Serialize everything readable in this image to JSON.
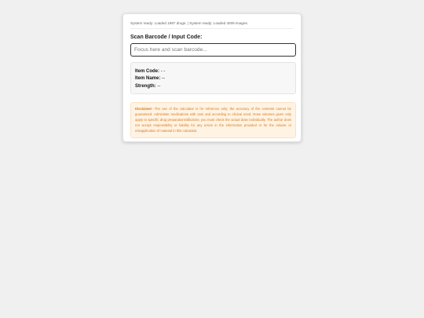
{
  "status": {
    "text": "System ready: Loaded 1987 drugs. | System ready: Loaded 4009 images."
  },
  "scan": {
    "label": "Scan Barcode / Input Code:",
    "placeholder": "Focus here and scan barcode...",
    "value": ""
  },
  "item": {
    "code_label": "Item Code:",
    "code_value": "- -",
    "name_label": "Item Name:",
    "name_value": "--",
    "strength_label": "Strength:",
    "strength_value": "--"
  },
  "disclaimer": {
    "label": "Disclaimer:",
    "text": "The use of the calculator is for reference only; the accuracy of the contents cannot be guaranteed. Administer medications with care and according to clinical need. Dose volumes given only apply to specific drug preparations/dilutions; you must check the actual dose individually. The author does not accept responsibility or liability for any errors in the information provided or for the misuse or misapplication of material in this calculator."
  },
  "colors": {
    "background": "#f0f0f1",
    "card": "#ffffff",
    "disclaimer_bg": "#fff3e3",
    "disclaimer_text": "#d97a1c"
  }
}
